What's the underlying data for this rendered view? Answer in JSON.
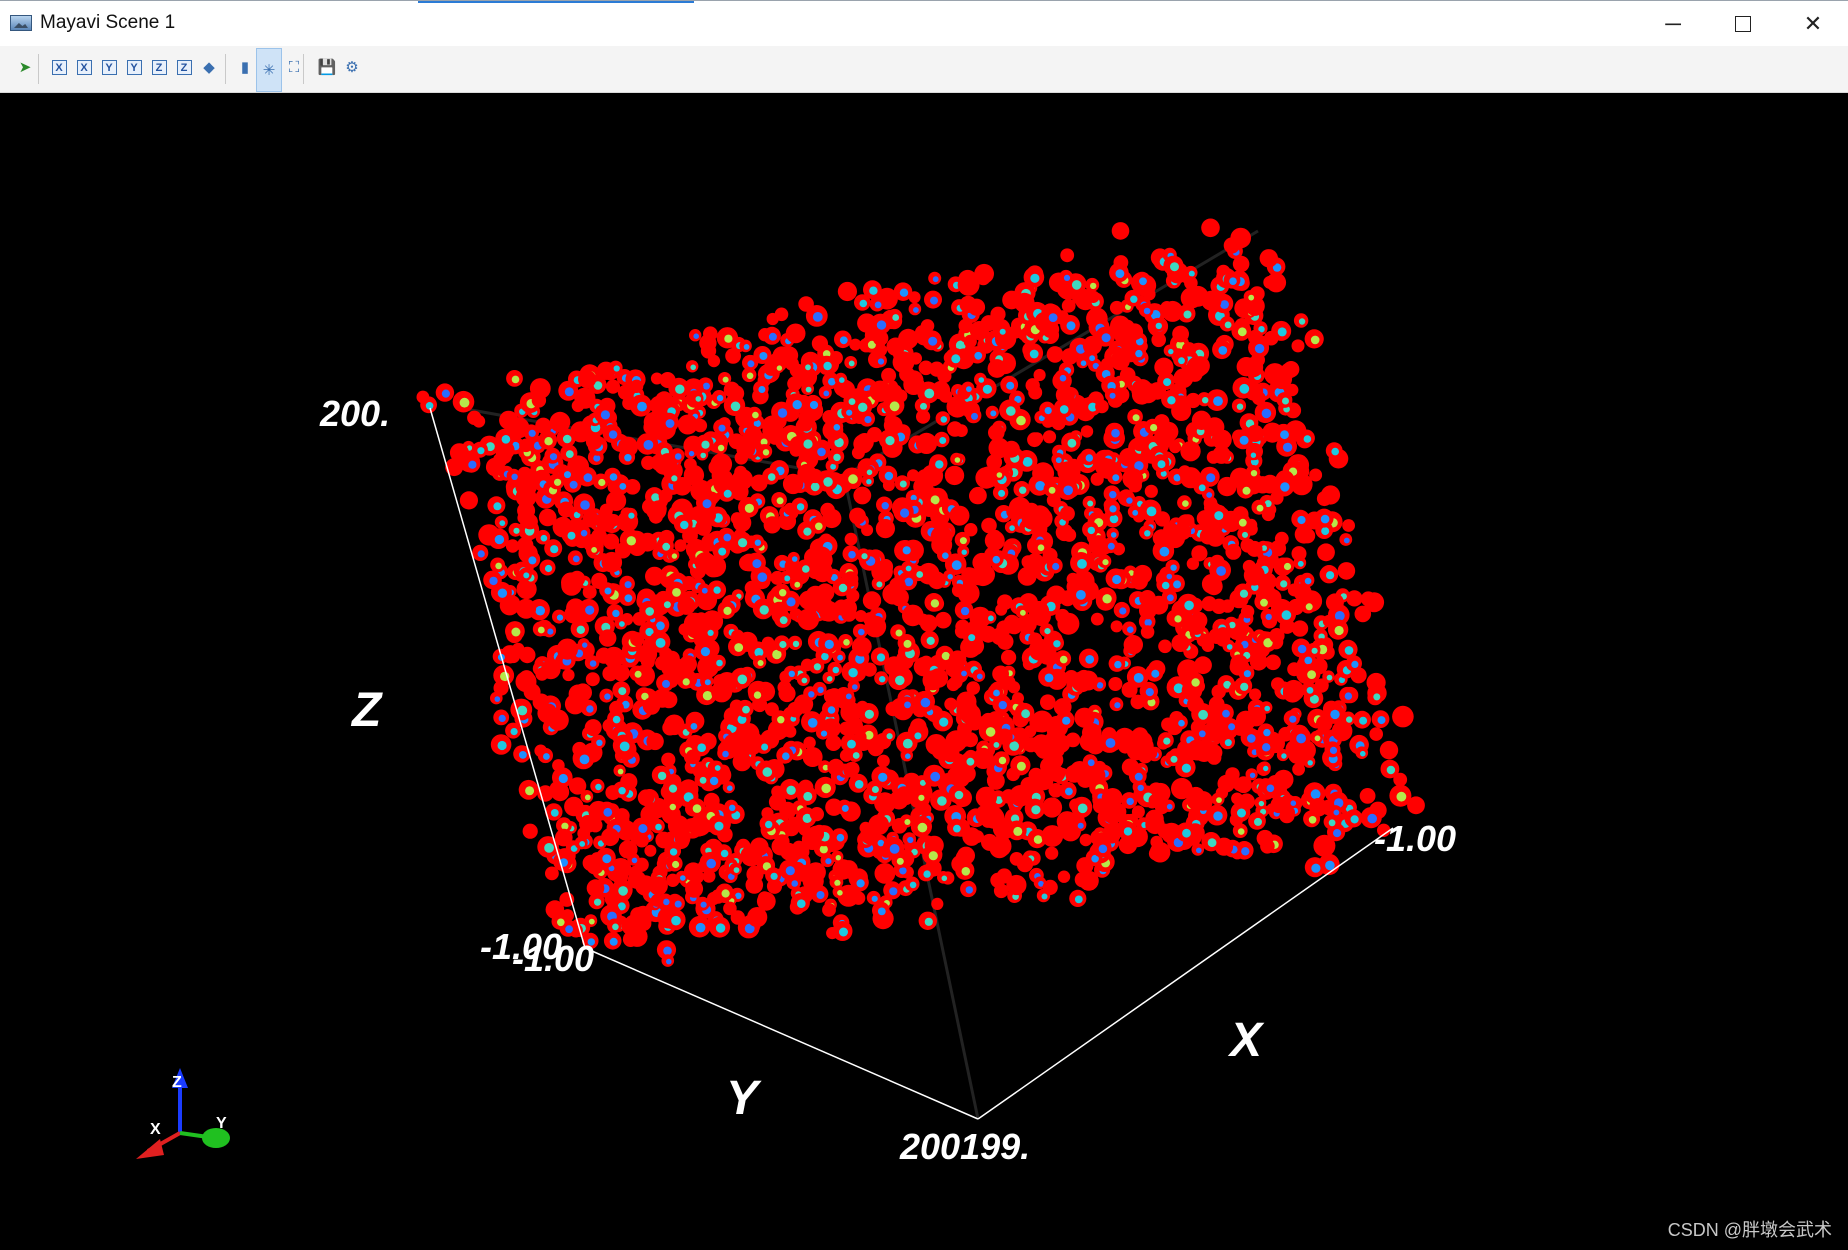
{
  "window": {
    "title": "Mayavi Scene 1"
  },
  "toolbar": {
    "buttons": [
      {
        "name": "mayavi-pipeline-icon",
        "glyph": "➤"
      },
      {
        "name": "view-x-plus-icon",
        "glyph": "X"
      },
      {
        "name": "view-x-minus-icon",
        "glyph": "X"
      },
      {
        "name": "view-y-plus-icon",
        "glyph": "Y"
      },
      {
        "name": "view-y-minus-icon",
        "glyph": "Y"
      },
      {
        "name": "view-z-plus-icon",
        "glyph": "Z"
      },
      {
        "name": "view-z-minus-icon",
        "glyph": "Z"
      },
      {
        "name": "isometric-view-icon",
        "glyph": "◆"
      },
      {
        "name": "parallel-projection-icon",
        "glyph": "▮"
      },
      {
        "name": "axes-indicator-icon",
        "glyph": "✳"
      },
      {
        "name": "full-screen-icon",
        "glyph": "⛶"
      },
      {
        "name": "save-icon",
        "glyph": "💾"
      },
      {
        "name": "configure-icon",
        "glyph": "⚙"
      }
    ]
  },
  "axes": {
    "z_max_label": "200.",
    "z_axis_title": "Z",
    "y_min_label_a": "-1.00",
    "y_min_label_b": "-1.00",
    "y_axis_title": "Y",
    "x_max_label": "200199.",
    "x_axis_title": "X",
    "x_min_label": "-1.00"
  },
  "orientation": {
    "z": "Z",
    "x": "X",
    "y": "Y"
  },
  "scene": {
    "colors": {
      "background": "#000000",
      "blobs": "#ff0000",
      "core": "#1ec8e0",
      "axis": "#ffffff"
    }
  },
  "watermark": "CSDN @胖墩会武术"
}
